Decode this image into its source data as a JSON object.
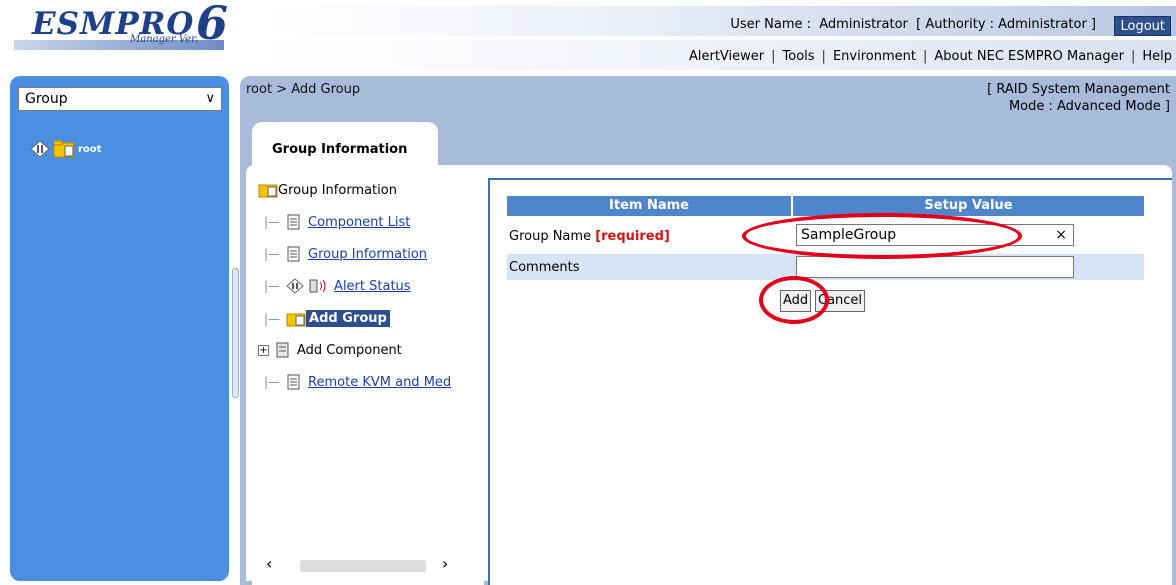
{
  "header": {
    "logo_text": "ESMPRO",
    "logo_number": "6",
    "logo_sub": "Manager Ver.",
    "user_info": "User Name :  Administrator  [ Authority : Administrator ]",
    "logout_label": "Logout",
    "menu": [
      "AlertViewer",
      "Tools",
      "Environment",
      "About NEC ESMPRO Manager",
      "Help"
    ]
  },
  "sidebar": {
    "selector_value": "Group",
    "root_label": "root"
  },
  "main": {
    "breadcrumb": "root > Add Group",
    "mode_line1": "[ RAID System Management",
    "mode_line2": "Mode : Advanced Mode ]",
    "tab_label": "Group Information",
    "subtree": {
      "root_label": "Group Information",
      "items": [
        "Component List",
        "Group Information",
        "Alert Status",
        "Add Group",
        "Add Component",
        "Remote KVM and Med"
      ]
    },
    "form": {
      "col_item": "Item Name",
      "col_value": "Setup Value",
      "group_name_label": "Group Name ",
      "required_label": "[required]",
      "group_name_value": "SampleGroup",
      "clear_symbol": "×",
      "comments_label": "Comments",
      "comments_value": "",
      "add_label": "Add",
      "cancel_label": "Cancel"
    }
  },
  "colors": {
    "sidebar": "#4a8fe2",
    "panel": "#a9bbdb",
    "header_cell": "#4f86cb",
    "required": "#d51515",
    "highlight_oval": "#e2001a"
  }
}
